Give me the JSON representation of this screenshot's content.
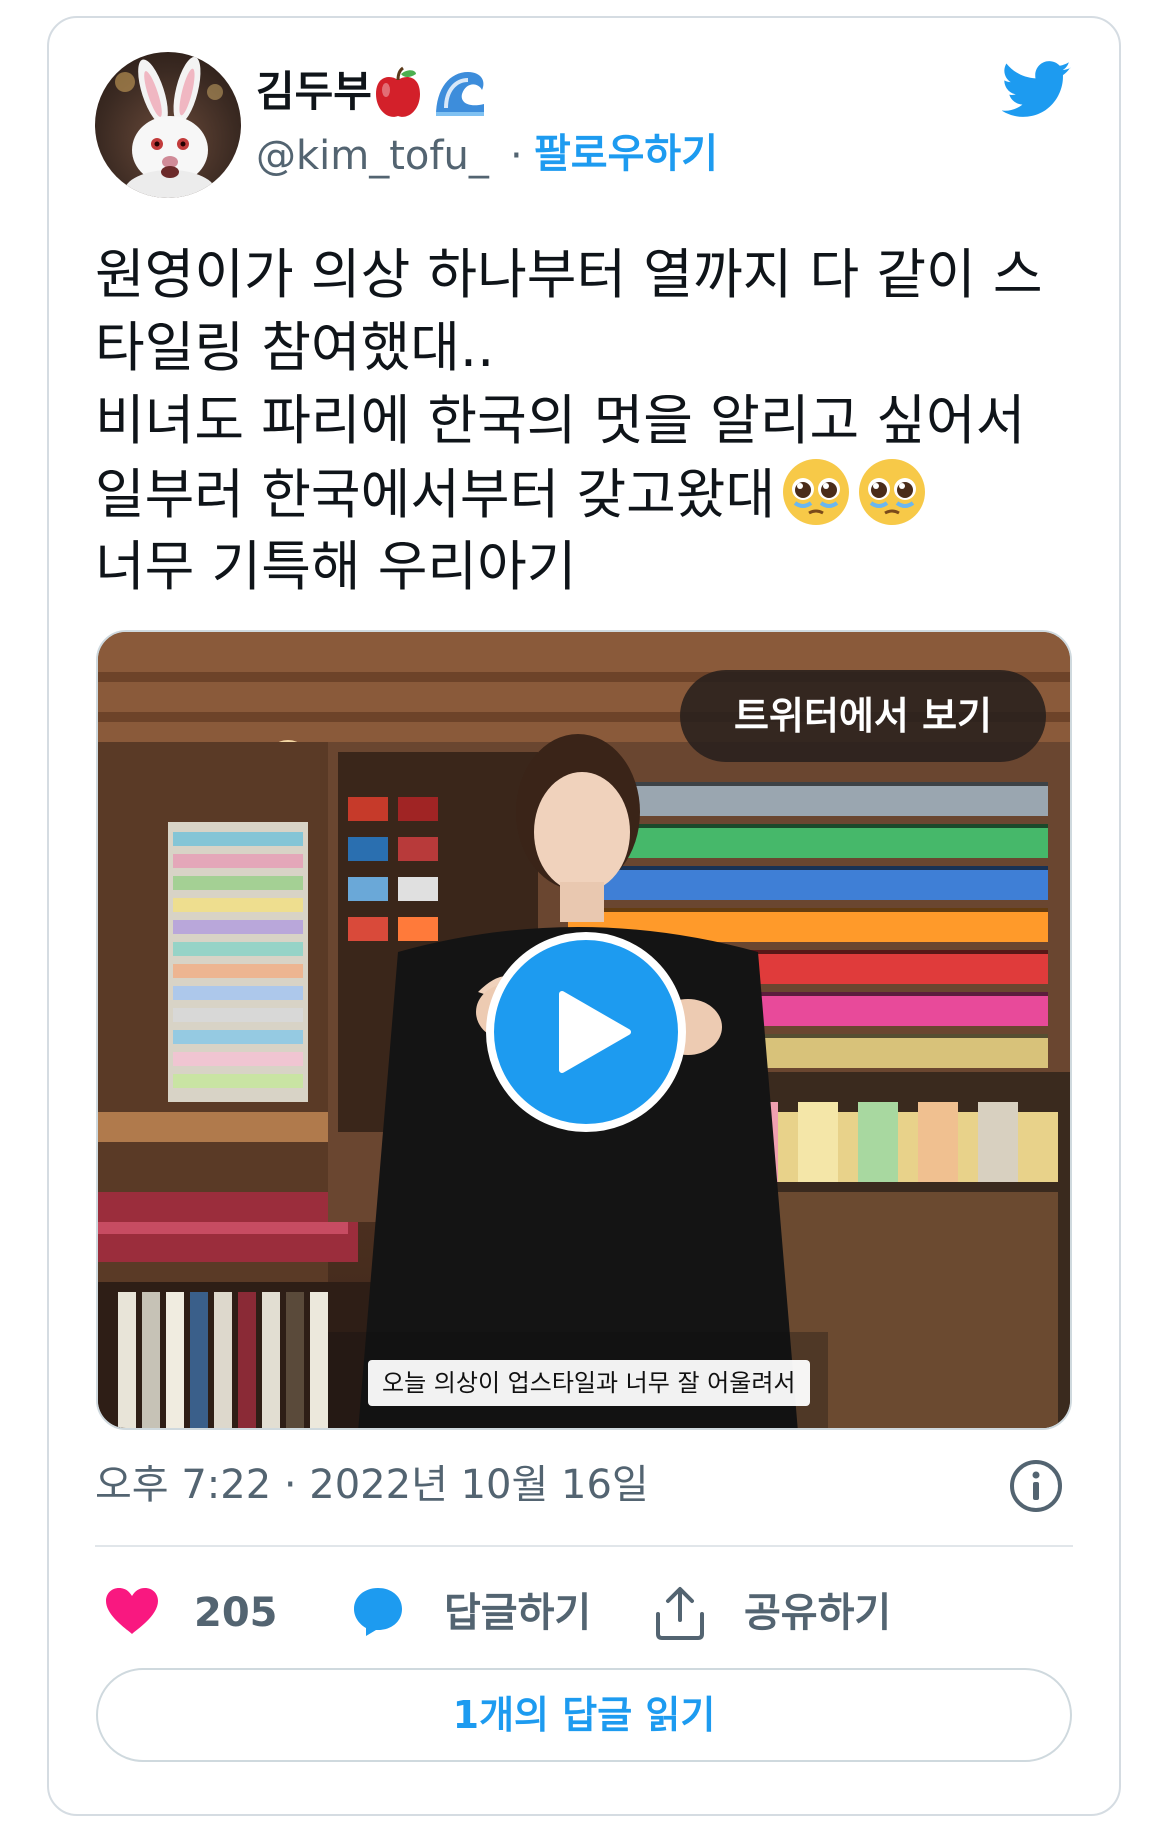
{
  "author": {
    "display_name": "김두부",
    "handle": "@kim_tofu_",
    "separator": "·",
    "follow_label": "팔로우하기"
  },
  "tweet": {
    "lines": [
      "원영이가 의상 하나부터 열까지 다 같이 스",
      "타일링 참여했대..",
      "비녀도 파리에 한국의 멋을 알리고 싶어서",
      "일부러 한국에서부터 갖고왔대",
      "너무 기특해 우리아기"
    ]
  },
  "media": {
    "view_on_twitter_label": "트위터에서 보기",
    "subtitle": "오늘 의상이 업스타일과 너무 잘 어울려서"
  },
  "meta": {
    "timestamp": "오후 7:22 · 2022년 10월 16일"
  },
  "actions": {
    "like_count": "205",
    "reply_label": "답글하기",
    "share_label": "공유하기"
  },
  "read_replies_label": "1개의 답글 읽기",
  "icons": {
    "brand": "twitter-bird-icon",
    "like": "heart-icon",
    "reply": "speech-bubble-icon",
    "share": "share-icon",
    "info": "info-icon"
  },
  "colors": {
    "accent": "#1d9bf0",
    "like": "#f91880",
    "muted_text": "#536471",
    "text": "#0f1419",
    "border": "#cfd9de"
  }
}
